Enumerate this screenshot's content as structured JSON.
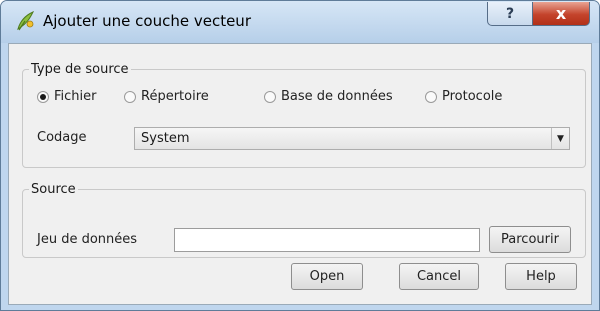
{
  "window": {
    "title": "Ajouter une couche vecteur",
    "help_button": "?",
    "close_button": "x"
  },
  "source_type": {
    "legend": "Type de source",
    "options": [
      "Fichier",
      "Répertoire",
      "Base de données",
      "Protocole"
    ],
    "selected": "Fichier",
    "encoding_label": "Codage",
    "encoding_value": "System"
  },
  "source": {
    "legend": "Source",
    "dataset_label": "Jeu de données",
    "dataset_value": "",
    "browse_button": "Parcourir"
  },
  "buttons": {
    "open": "Open",
    "cancel": "Cancel",
    "help": "Help"
  },
  "colors": {
    "titlebar": "#bfd6ee",
    "close_button": "#c4432b",
    "client_background": "#f0f0f0"
  },
  "icons": {
    "app": "qgis-logo-icon",
    "dropdown": "chevron-down-icon"
  }
}
